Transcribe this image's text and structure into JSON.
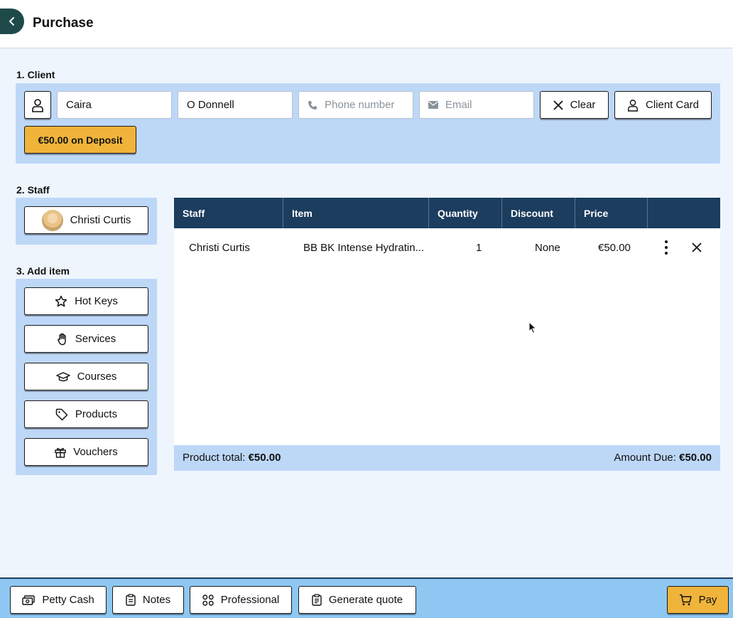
{
  "header": {
    "title": "Purchase"
  },
  "client": {
    "label": "1. Client",
    "first_name": "Caira",
    "last_name": "O Donnell",
    "phone_placeholder": "Phone number",
    "email_placeholder": "Email",
    "clear_label": "Clear",
    "client_card_label": "Client Card",
    "deposit_label": "€50.00 on Deposit"
  },
  "staff": {
    "label": "2. Staff",
    "selected": "Christi Curtis"
  },
  "add_item": {
    "label": "3. Add item",
    "buttons": [
      {
        "label": "Hot Keys",
        "icon": "star-icon"
      },
      {
        "label": "Services",
        "icon": "hand-icon"
      },
      {
        "label": "Courses",
        "icon": "graduation-cap-icon"
      },
      {
        "label": "Products",
        "icon": "tag-icon"
      },
      {
        "label": "Vouchers",
        "icon": "gift-icon"
      }
    ]
  },
  "table": {
    "headers": [
      "Staff",
      "Item",
      "Quantity",
      "Discount",
      "Price"
    ],
    "rows": [
      {
        "staff": "Christi Curtis",
        "item": "BB BK Intense Hydratin...",
        "quantity": "1",
        "discount": "None",
        "price": "€50.00"
      }
    ],
    "footer": {
      "product_total_label": "Product total:",
      "product_total_value": "€50.00",
      "amount_due_label": "Amount Due:",
      "amount_due_value": "€50.00"
    }
  },
  "bottom_bar": {
    "petty_cash": "Petty Cash",
    "notes": "Notes",
    "professional": "Professional",
    "generate_quote": "Generate quote",
    "pay": "Pay"
  },
  "colors": {
    "header_dark": "#1c3d5e",
    "panel": "#bdd7f7",
    "accent": "#f0b43a",
    "back_button": "#1f4a4a"
  }
}
